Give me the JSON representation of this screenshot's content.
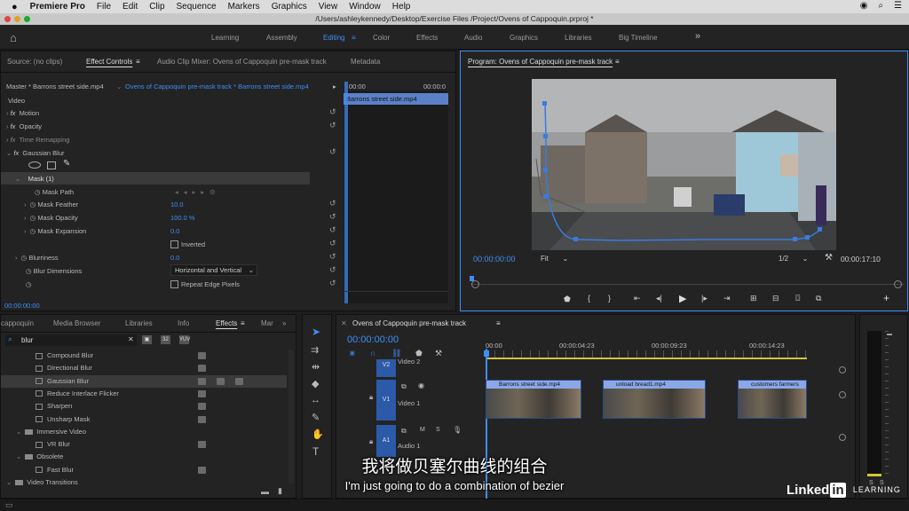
{
  "menubar": {
    "apple": "",
    "app_name": "Premiere Pro",
    "items": [
      "File",
      "Edit",
      "Clip",
      "Sequence",
      "Markers",
      "Graphics",
      "View",
      "Window",
      "Help"
    ],
    "right_icons": [
      "creative-cloud-icon",
      "search-icon",
      "list-icon"
    ]
  },
  "window": {
    "title": "/Users/ashleykennedy/Desktop/Exercise Files /Project/Ovens of Cappoquin.prproj *"
  },
  "workspaces": {
    "items": [
      "Learning",
      "Assembly",
      "Editing",
      "Color",
      "Effects",
      "Audio",
      "Graphics",
      "Libraries",
      "Big Timeline"
    ],
    "active": "Editing",
    "more": "»"
  },
  "source_panel": {
    "tabs": [
      "Source: (no clips)",
      "Effect Controls",
      "Audio Clip Mixer: Ovens of Cappoquin pre-mask track",
      "Metadata"
    ],
    "active_tab": "Effect Controls",
    "master_label": "Master * Barrons street side.mp4",
    "sequence_label": "Ovens of Cappoquin pre-mask track * Barrons street side.mp4",
    "time_start": "00:00",
    "time_end": "00:00:0",
    "clip_bar": "Barrons street side.mp4",
    "section_video": "Video",
    "rows": [
      {
        "name": "Motion",
        "value": ""
      },
      {
        "name": "Opacity",
        "value": ""
      },
      {
        "name": "Time Remapping",
        "value": ""
      },
      {
        "name": "Gaussian Blur",
        "value": ""
      },
      {
        "name": "Mask (1)",
        "value": ""
      },
      {
        "name": "Mask Path",
        "value": ""
      },
      {
        "name": "Mask Feather",
        "value": "10.0"
      },
      {
        "name": "Mask Opacity",
        "value": "100.0 %"
      },
      {
        "name": "Mask Expansion",
        "value": "0.0"
      },
      {
        "name": "Inverted",
        "value": ""
      },
      {
        "name": "Blurriness",
        "value": "0.0"
      },
      {
        "name": "Blur Dimensions",
        "value": "Horizontal and Vertical"
      },
      {
        "name": "",
        "value": "Repeat Edge Pixels"
      }
    ],
    "current_time": "00:00:00:00"
  },
  "program_monitor": {
    "title": "Program: Ovens of Cappoquin pre-mask track",
    "timecode": "00:00:00:00",
    "fit": "Fit",
    "resolution": "1/2",
    "duration": "00:00:17:10"
  },
  "project_panel": {
    "tabs": [
      "cappoquin",
      "Media Browser",
      "Libraries",
      "Info",
      "Effects",
      "Mar"
    ],
    "active_tab": "Effects",
    "search_value": "blur",
    "tree": [
      {
        "label": "Compound Blur",
        "type": "fx",
        "indent": 3,
        "selected": false
      },
      {
        "label": "Directional Blur",
        "type": "fx",
        "indent": 3,
        "selected": false
      },
      {
        "label": "Gaussian Blur",
        "type": "fx",
        "indent": 3,
        "selected": true
      },
      {
        "label": "Reduce Interlace Flicker",
        "type": "fx",
        "indent": 3,
        "selected": false
      },
      {
        "label": "Sharpen",
        "type": "fx",
        "indent": 3,
        "selected": false
      },
      {
        "label": "Unsharp Mask",
        "type": "fx",
        "indent": 3,
        "selected": false
      },
      {
        "label": "Immersive Video",
        "type": "folder",
        "indent": 1,
        "selected": false
      },
      {
        "label": "VR Blur",
        "type": "fx",
        "indent": 3,
        "selected": false
      },
      {
        "label": "Obsolete",
        "type": "folder",
        "indent": 1,
        "selected": false
      },
      {
        "label": "Fast Blur",
        "type": "fx",
        "indent": 3,
        "selected": false
      },
      {
        "label": "Video Transitions",
        "type": "folder",
        "indent": 0,
        "selected": false
      }
    ]
  },
  "timeline": {
    "title": "Ovens of Cappoquin pre-mask track",
    "timecode": "00:00:00:00",
    "ruler": [
      "00:00",
      "00:00:04:23",
      "00:00:09:23",
      "00:00:14:23"
    ],
    "tracks": [
      {
        "id": "V2",
        "name": "Video 2"
      },
      {
        "id": "V1",
        "name": "Video 1"
      },
      {
        "id": "A1",
        "name": "Audio 1"
      }
    ],
    "clips": [
      {
        "label": "Barrons street side.mp4"
      },
      {
        "label": "unload bread1.mp4"
      },
      {
        "label": "customers farmers"
      }
    ]
  },
  "audio_meter": {
    "labels": [
      "S",
      "S"
    ]
  },
  "subtitles": {
    "zh": "我将做贝塞尔曲线的组合",
    "en": "I'm just going to do a combination of bezier"
  },
  "watermark": {
    "brand": "Linked",
    "brand_box": "in",
    "suffix": "LEARNING"
  },
  "colors": {
    "accent": "#3e8ef7",
    "mask_path": "#3a7be0",
    "clip": "#6a8fd8"
  }
}
